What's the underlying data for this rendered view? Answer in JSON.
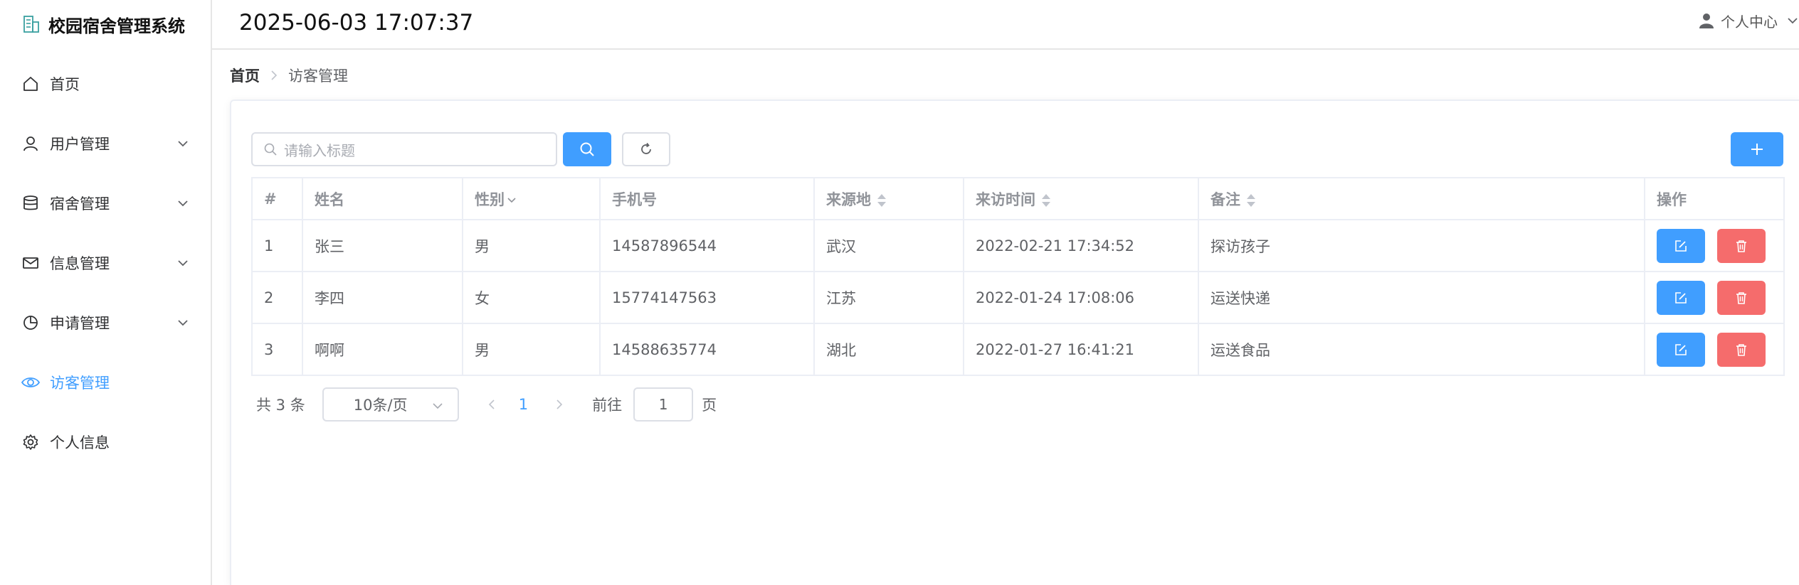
{
  "app": {
    "title": "校园宿舍管理系统"
  },
  "header": {
    "datetime": "2025-06-03 17:07:37",
    "user_menu_label": "个人中心"
  },
  "sidebar": {
    "items": [
      {
        "label": "首页",
        "icon": "home-icon"
      },
      {
        "label": "用户管理",
        "icon": "user-icon",
        "expandable": true
      },
      {
        "label": "宿舍管理",
        "icon": "database-icon",
        "expandable": true
      },
      {
        "label": "信息管理",
        "icon": "mail-icon",
        "expandable": true
      },
      {
        "label": "申请管理",
        "icon": "pie-chart-icon",
        "expandable": true
      },
      {
        "label": "访客管理",
        "icon": "eye-icon",
        "active": true
      },
      {
        "label": "个人信息",
        "icon": "gear-icon"
      }
    ]
  },
  "breadcrumb": {
    "home": "首页",
    "current": "访客管理"
  },
  "search": {
    "placeholder": "请输入标题"
  },
  "table": {
    "columns": [
      "#",
      "姓名",
      "性别",
      "手机号",
      "来源地",
      "来访时间",
      "备注",
      "操作"
    ],
    "rows": [
      {
        "index": "1",
        "name": "张三",
        "gender": "男",
        "phone": "14587896544",
        "origin": "武汉",
        "visit_time": "2022-02-21 17:34:52",
        "remark": "探访孩子"
      },
      {
        "index": "2",
        "name": "李四",
        "gender": "女",
        "phone": "15774147563",
        "origin": "江苏",
        "visit_time": "2022-01-24 17:08:06",
        "remark": "运送快递"
      },
      {
        "index": "3",
        "name": "啊啊",
        "gender": "男",
        "phone": "14588635774",
        "origin": "湖北",
        "visit_time": "2022-01-27 16:41:21",
        "remark": "运送食品"
      }
    ]
  },
  "pagination": {
    "total": "共 3 条",
    "page_size": "10条/页",
    "current_page": "1",
    "goto_label": "前往",
    "goto_value": "1",
    "page_suffix": "页"
  },
  "colors": {
    "primary": "#409eff",
    "danger": "#f56c6c",
    "active_text": "#409eff"
  }
}
